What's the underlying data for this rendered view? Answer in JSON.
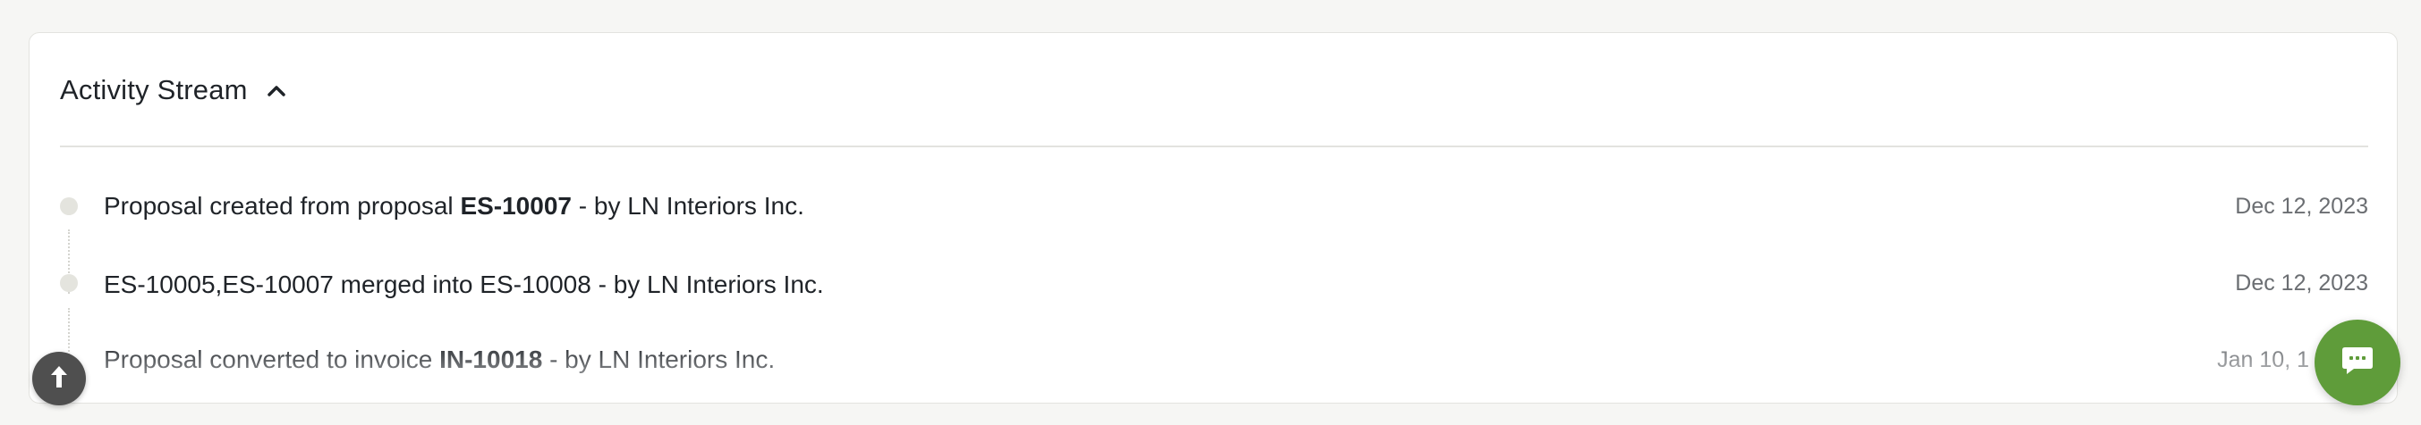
{
  "activity_stream": {
    "title": "Activity Stream",
    "collapse_icon": "chevron-up-icon",
    "events": [
      {
        "prefix": "Proposal created from proposal ",
        "ref": "ES-10007",
        "suffix": " - by LN Interiors Inc.",
        "date": "Dec 12, 2023"
      },
      {
        "prefix": "ES-10005,ES-10007 merged into ES-10008 - by LN Interiors Inc.",
        "ref": "",
        "suffix": "",
        "date": "Dec 12, 2023"
      },
      {
        "prefix": "Proposal converted to invoice ",
        "ref": "IN-10018",
        "suffix": " - by LN Interiors Inc.",
        "date": "Jan 10, 1"
      }
    ]
  },
  "floating_buttons": {
    "scroll_top_icon": "arrow-up-icon",
    "chat_icon": "chat-bubble-icon"
  },
  "colors": {
    "chat_button": "#5f9c3a",
    "scroll_button": "#4f4f4f",
    "timeline_dot": "#e4e4de"
  }
}
